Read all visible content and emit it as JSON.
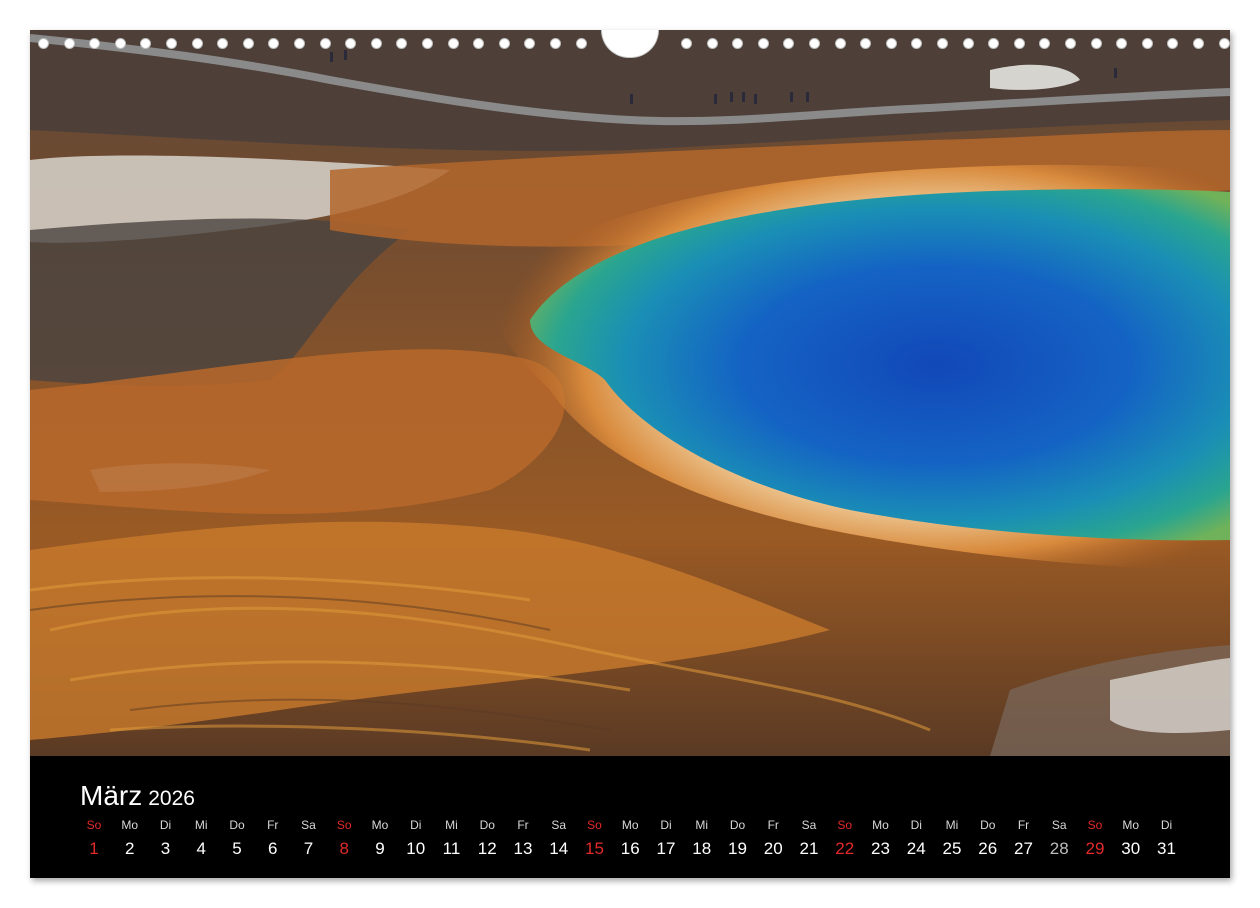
{
  "calendar": {
    "month": "März",
    "year": "2026",
    "days": [
      {
        "dow": "So",
        "num": "1"
      },
      {
        "dow": "Mo",
        "num": "2"
      },
      {
        "dow": "Di",
        "num": "3"
      },
      {
        "dow": "Mi",
        "num": "4"
      },
      {
        "dow": "Do",
        "num": "5"
      },
      {
        "dow": "Fr",
        "num": "6"
      },
      {
        "dow": "Sa",
        "num": "7"
      },
      {
        "dow": "So",
        "num": "8"
      },
      {
        "dow": "Mo",
        "num": "9"
      },
      {
        "dow": "Di",
        "num": "10"
      },
      {
        "dow": "Mi",
        "num": "11"
      },
      {
        "dow": "Do",
        "num": "12"
      },
      {
        "dow": "Fr",
        "num": "13"
      },
      {
        "dow": "Sa",
        "num": "14"
      },
      {
        "dow": "So",
        "num": "15"
      },
      {
        "dow": "Mo",
        "num": "16"
      },
      {
        "dow": "Di",
        "num": "17"
      },
      {
        "dow": "Mi",
        "num": "18"
      },
      {
        "dow": "Do",
        "num": "19"
      },
      {
        "dow": "Fr",
        "num": "20"
      },
      {
        "dow": "Sa",
        "num": "21"
      },
      {
        "dow": "So",
        "num": "22"
      },
      {
        "dow": "Mo",
        "num": "23"
      },
      {
        "dow": "Di",
        "num": "24"
      },
      {
        "dow": "Mi",
        "num": "25"
      },
      {
        "dow": "Do",
        "num": "26"
      },
      {
        "dow": "Fr",
        "num": "27"
      },
      {
        "dow": "Sa",
        "num": "28"
      },
      {
        "dow": "So",
        "num": "29"
      },
      {
        "dow": "Mo",
        "num": "30"
      },
      {
        "dow": "Di",
        "num": "31"
      }
    ]
  },
  "colors": {
    "sunday": "#e32a2a",
    "calendar_background": "#000000",
    "pool_blue": "#1560c8",
    "pool_teal": "#2aa89a",
    "bacterial_orange": "#c8762a"
  },
  "photo": {
    "subject": "hot-spring-pool-aerial-photo"
  }
}
